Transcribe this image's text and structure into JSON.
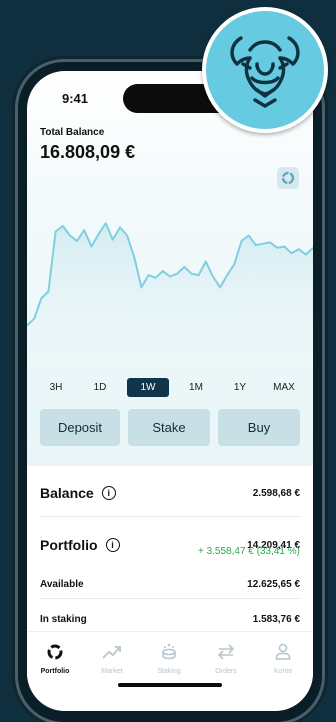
{
  "status": {
    "time": "9:41"
  },
  "header": {
    "total_balance_label": "Total Balance",
    "total_balance_value": "16.808,09 €"
  },
  "chart_data": {
    "type": "line",
    "x": [
      0,
      1,
      2,
      3,
      4,
      5,
      6,
      7,
      8,
      9,
      10,
      11,
      12,
      13,
      14,
      15,
      16,
      17,
      18,
      19,
      20,
      21,
      22,
      23,
      24,
      25,
      26,
      27,
      28,
      29,
      30,
      31,
      32,
      33,
      34,
      35,
      36,
      37,
      38,
      39,
      40
    ],
    "values": [
      26,
      31,
      46,
      51,
      95,
      99,
      92,
      88,
      96,
      84,
      93,
      101,
      89,
      98,
      92,
      76,
      54,
      63,
      61,
      66,
      62,
      64,
      69,
      64,
      63,
      73,
      62,
      54,
      63,
      71,
      88,
      92,
      85,
      86,
      87,
      83,
      84,
      79,
      82,
      78,
      83
    ],
    "ylim": [
      0,
      110
    ],
    "grid": false,
    "color": "#7ed0e0"
  },
  "ranges": [
    "3H",
    "1D",
    "1W",
    "1M",
    "1Y",
    "MAX"
  ],
  "selected_range": "1W",
  "actions": {
    "deposit": "Deposit",
    "stake": "Stake",
    "buy": "Buy"
  },
  "balance": {
    "label": "Balance",
    "value": "2.598,68 €"
  },
  "portfolio": {
    "label": "Portfolio",
    "value": "14.209,41 €",
    "gain": "+ 3.558,47 € (33,41 %)"
  },
  "available": {
    "label": "Available",
    "value": "12.625,65 €"
  },
  "in_staking": {
    "label": "In staking",
    "value": "1.583,76 €"
  },
  "tabs": [
    {
      "label": "Portfolio",
      "icon": "portfolio-icon"
    },
    {
      "label": "Market",
      "icon": "market-icon"
    },
    {
      "label": "Staking",
      "icon": "staking-icon"
    },
    {
      "label": "Orders",
      "icon": "orders-icon"
    },
    {
      "label": "Konto",
      "icon": "account-icon"
    }
  ],
  "colors": {
    "accent": "#10354a",
    "chart_line": "#7ed0e0",
    "gain": "#2fa84f",
    "logo_bg": "#66cbe0"
  }
}
